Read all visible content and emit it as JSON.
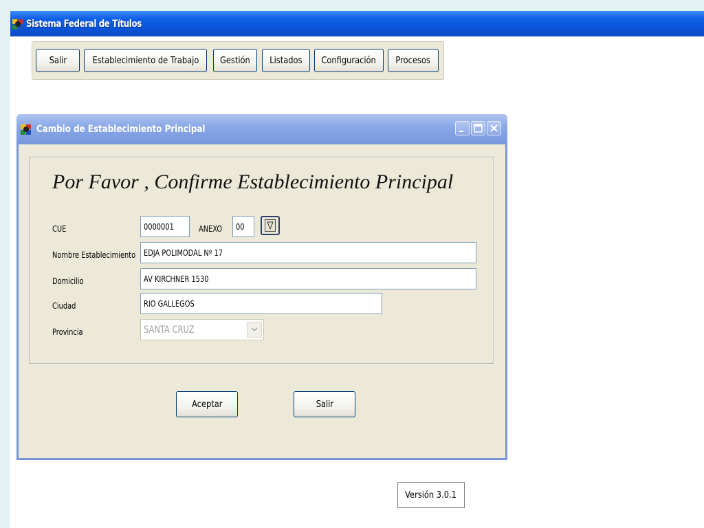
{
  "app": {
    "title": "Sistema Federal de Títulos",
    "icon": "app-logo-icon"
  },
  "menu": {
    "items": [
      {
        "label": "Salir"
      },
      {
        "label": "Establecimiento de Trabajo"
      },
      {
        "label": "Gestión"
      },
      {
        "label": "Listados"
      },
      {
        "label": "Configuración"
      },
      {
        "label": "Procesos"
      }
    ]
  },
  "dialog": {
    "title": "Cambio de Establecimiento Principal",
    "heading": "Por Favor , Confirme Establecimiento Principal",
    "fields": {
      "cue": {
        "label": "CUE",
        "value": "0000001"
      },
      "anexo": {
        "label": "ANEXO",
        "value": "00"
      },
      "nombre": {
        "label": "Nombre Establecimiento",
        "value": "EDJA POLIMODAL Nº 17"
      },
      "domicilio": {
        "label": "Domicilio",
        "value": "AV KIRCHNER 1530"
      },
      "ciudad": {
        "label": "Ciudad",
        "value": "RIO GALLEGOS"
      },
      "provincia": {
        "label": "Provincia",
        "value": "SANTA CRUZ"
      }
    },
    "buttons": {
      "accept": "Aceptar",
      "exit": "Salir"
    }
  },
  "version": "Versión 3.0.1",
  "colors": {
    "titlebar": "#0a53d8",
    "dialog_titlebar": "#8aa9e8",
    "panel": "#ece9d8",
    "button_border": "#003c74"
  }
}
